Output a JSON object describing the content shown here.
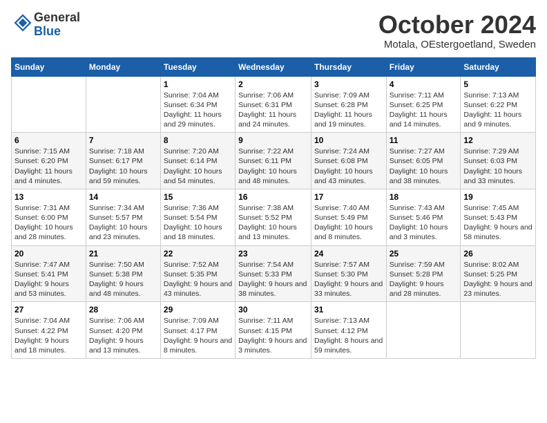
{
  "header": {
    "logo_line1": "General",
    "logo_line2": "Blue",
    "month_year": "October 2024",
    "location": "Motala, OEstergoetland, Sweden"
  },
  "weekdays": [
    "Sunday",
    "Monday",
    "Tuesday",
    "Wednesday",
    "Thursday",
    "Friday",
    "Saturday"
  ],
  "weeks": [
    [
      {
        "day": "",
        "sunrise": "",
        "sunset": "",
        "daylight": ""
      },
      {
        "day": "",
        "sunrise": "",
        "sunset": "",
        "daylight": ""
      },
      {
        "day": "1",
        "sunrise": "Sunrise: 7:04 AM",
        "sunset": "Sunset: 6:34 PM",
        "daylight": "Daylight: 11 hours and 29 minutes."
      },
      {
        "day": "2",
        "sunrise": "Sunrise: 7:06 AM",
        "sunset": "Sunset: 6:31 PM",
        "daylight": "Daylight: 11 hours and 24 minutes."
      },
      {
        "day": "3",
        "sunrise": "Sunrise: 7:09 AM",
        "sunset": "Sunset: 6:28 PM",
        "daylight": "Daylight: 11 hours and 19 minutes."
      },
      {
        "day": "4",
        "sunrise": "Sunrise: 7:11 AM",
        "sunset": "Sunset: 6:25 PM",
        "daylight": "Daylight: 11 hours and 14 minutes."
      },
      {
        "day": "5",
        "sunrise": "Sunrise: 7:13 AM",
        "sunset": "Sunset: 6:22 PM",
        "daylight": "Daylight: 11 hours and 9 minutes."
      }
    ],
    [
      {
        "day": "6",
        "sunrise": "Sunrise: 7:15 AM",
        "sunset": "Sunset: 6:20 PM",
        "daylight": "Daylight: 11 hours and 4 minutes."
      },
      {
        "day": "7",
        "sunrise": "Sunrise: 7:18 AM",
        "sunset": "Sunset: 6:17 PM",
        "daylight": "Daylight: 10 hours and 59 minutes."
      },
      {
        "day": "8",
        "sunrise": "Sunrise: 7:20 AM",
        "sunset": "Sunset: 6:14 PM",
        "daylight": "Daylight: 10 hours and 54 minutes."
      },
      {
        "day": "9",
        "sunrise": "Sunrise: 7:22 AM",
        "sunset": "Sunset: 6:11 PM",
        "daylight": "Daylight: 10 hours and 48 minutes."
      },
      {
        "day": "10",
        "sunrise": "Sunrise: 7:24 AM",
        "sunset": "Sunset: 6:08 PM",
        "daylight": "Daylight: 10 hours and 43 minutes."
      },
      {
        "day": "11",
        "sunrise": "Sunrise: 7:27 AM",
        "sunset": "Sunset: 6:05 PM",
        "daylight": "Daylight: 10 hours and 38 minutes."
      },
      {
        "day": "12",
        "sunrise": "Sunrise: 7:29 AM",
        "sunset": "Sunset: 6:03 PM",
        "daylight": "Daylight: 10 hours and 33 minutes."
      }
    ],
    [
      {
        "day": "13",
        "sunrise": "Sunrise: 7:31 AM",
        "sunset": "Sunset: 6:00 PM",
        "daylight": "Daylight: 10 hours and 28 minutes."
      },
      {
        "day": "14",
        "sunrise": "Sunrise: 7:34 AM",
        "sunset": "Sunset: 5:57 PM",
        "daylight": "Daylight: 10 hours and 23 minutes."
      },
      {
        "day": "15",
        "sunrise": "Sunrise: 7:36 AM",
        "sunset": "Sunset: 5:54 PM",
        "daylight": "Daylight: 10 hours and 18 minutes."
      },
      {
        "day": "16",
        "sunrise": "Sunrise: 7:38 AM",
        "sunset": "Sunset: 5:52 PM",
        "daylight": "Daylight: 10 hours and 13 minutes."
      },
      {
        "day": "17",
        "sunrise": "Sunrise: 7:40 AM",
        "sunset": "Sunset: 5:49 PM",
        "daylight": "Daylight: 10 hours and 8 minutes."
      },
      {
        "day": "18",
        "sunrise": "Sunrise: 7:43 AM",
        "sunset": "Sunset: 5:46 PM",
        "daylight": "Daylight: 10 hours and 3 minutes."
      },
      {
        "day": "19",
        "sunrise": "Sunrise: 7:45 AM",
        "sunset": "Sunset: 5:43 PM",
        "daylight": "Daylight: 9 hours and 58 minutes."
      }
    ],
    [
      {
        "day": "20",
        "sunrise": "Sunrise: 7:47 AM",
        "sunset": "Sunset: 5:41 PM",
        "daylight": "Daylight: 9 hours and 53 minutes."
      },
      {
        "day": "21",
        "sunrise": "Sunrise: 7:50 AM",
        "sunset": "Sunset: 5:38 PM",
        "daylight": "Daylight: 9 hours and 48 minutes."
      },
      {
        "day": "22",
        "sunrise": "Sunrise: 7:52 AM",
        "sunset": "Sunset: 5:35 PM",
        "daylight": "Daylight: 9 hours and 43 minutes."
      },
      {
        "day": "23",
        "sunrise": "Sunrise: 7:54 AM",
        "sunset": "Sunset: 5:33 PM",
        "daylight": "Daylight: 9 hours and 38 minutes."
      },
      {
        "day": "24",
        "sunrise": "Sunrise: 7:57 AM",
        "sunset": "Sunset: 5:30 PM",
        "daylight": "Daylight: 9 hours and 33 minutes."
      },
      {
        "day": "25",
        "sunrise": "Sunrise: 7:59 AM",
        "sunset": "Sunset: 5:28 PM",
        "daylight": "Daylight: 9 hours and 28 minutes."
      },
      {
        "day": "26",
        "sunrise": "Sunrise: 8:02 AM",
        "sunset": "Sunset: 5:25 PM",
        "daylight": "Daylight: 9 hours and 23 minutes."
      }
    ],
    [
      {
        "day": "27",
        "sunrise": "Sunrise: 7:04 AM",
        "sunset": "Sunset: 4:22 PM",
        "daylight": "Daylight: 9 hours and 18 minutes."
      },
      {
        "day": "28",
        "sunrise": "Sunrise: 7:06 AM",
        "sunset": "Sunset: 4:20 PM",
        "daylight": "Daylight: 9 hours and 13 minutes."
      },
      {
        "day": "29",
        "sunrise": "Sunrise: 7:09 AM",
        "sunset": "Sunset: 4:17 PM",
        "daylight": "Daylight: 9 hours and 8 minutes."
      },
      {
        "day": "30",
        "sunrise": "Sunrise: 7:11 AM",
        "sunset": "Sunset: 4:15 PM",
        "daylight": "Daylight: 9 hours and 3 minutes."
      },
      {
        "day": "31",
        "sunrise": "Sunrise: 7:13 AM",
        "sunset": "Sunset: 4:12 PM",
        "daylight": "Daylight: 8 hours and 59 minutes."
      },
      {
        "day": "",
        "sunrise": "",
        "sunset": "",
        "daylight": ""
      },
      {
        "day": "",
        "sunrise": "",
        "sunset": "",
        "daylight": ""
      }
    ]
  ]
}
